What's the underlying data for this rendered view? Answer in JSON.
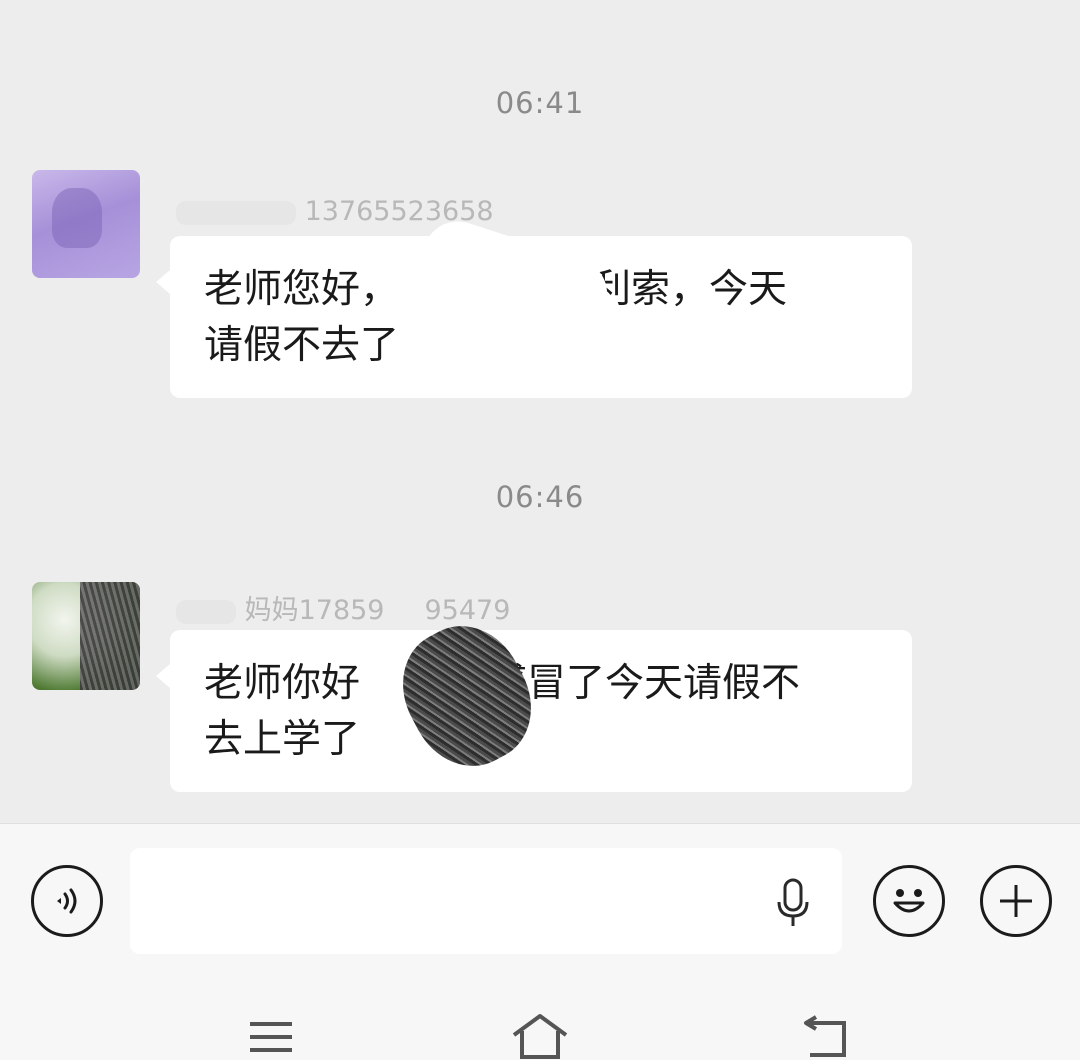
{
  "messages": [
    {
      "time": "06:41",
      "sender_visible": "13765523658",
      "text_line1_a": "老师您好，",
      "text_line1_b": "好利索，今天",
      "text_line2": "请假不去了"
    },
    {
      "time": "06:46",
      "sender_visible": "妈妈17859",
      "sender_visible_b": "95479",
      "text_line1_a": "老师你好",
      "text_line1_b": "感冒了今天请假不",
      "text_line2": "去上学了"
    }
  ],
  "input": {
    "value": "",
    "placeholder": ""
  },
  "icons": {
    "voice_toggle": "voice-wave-icon",
    "mic": "microphone-icon",
    "emoji": "smiley-icon",
    "more": "plus-icon",
    "nav_menu": "menu-icon",
    "nav_home": "home-icon",
    "nav_back": "back-icon"
  }
}
